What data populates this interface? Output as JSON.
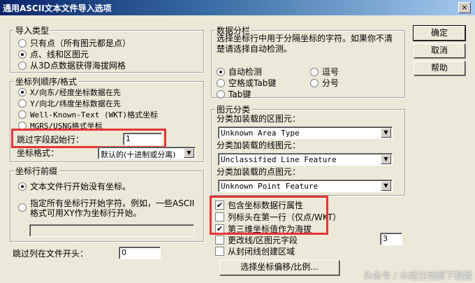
{
  "window": {
    "title": "通用ASCII文本文件导入选项",
    "close": "×"
  },
  "import_type": {
    "legend": "导入类型",
    "options": [
      "只有点（所有图元都是点）",
      "点、线和区图元",
      "从3D点数据获得海拔网格"
    ],
    "selected": 1
  },
  "coord_order": {
    "legend": "坐标列顺序/格式",
    "options": [
      "X/向东/经度坐标数据在先",
      "Y/向北/纬度坐标数据在先",
      "Well-Known-Text (WKT)格式坐标",
      "MGRS/USNG格式坐标"
    ],
    "selected": 0,
    "skip_label": "跳过字段起始行：",
    "skip_value": "1",
    "format_label": "坐标格式：",
    "format_value": "默认的(十进制或分离)"
  },
  "prefix": {
    "legend": "坐标行前缀",
    "options": [
      "文本文件行开始没有坐标。",
      "指定所有坐标行开始字符。例如，一些ASCII格式可用XY作为坐标行开始。"
    ],
    "selected": 0,
    "prefix_value": ""
  },
  "skip_columns": {
    "label": "跳过列在文件开头：",
    "value": "0"
  },
  "delimiter": {
    "legend": "数据分栏",
    "description": "选择坐标行中用于分隔坐标的字符。如果你不清楚请选择自动检测。",
    "options": [
      "自动检测",
      "逗号",
      "空格或Tab键",
      "分号",
      "Tab键"
    ],
    "selected": 0
  },
  "feature_class": {
    "legend": "图元分类",
    "area_label": "分类加装载的区图元：",
    "area_value": "Unknown Area Type",
    "line_label": "分类加装载的线图元：",
    "line_value": "Unclassified Line Feature",
    "point_label": "分类加装载的点图元：",
    "point_value": "Unknown Point Feature"
  },
  "checkboxes": {
    "include_attr": {
      "label": "包含坐标数据行属性",
      "checked": true
    },
    "column_header": {
      "label": "列标头在第一行（仅点/WKT）",
      "checked": false
    },
    "third_coord": {
      "label": "第三维坐标值作为海拔",
      "checked": true
    },
    "change_field": {
      "label": "更改线/区图元字段",
      "checked": false,
      "value": "3"
    },
    "closed_line": {
      "label": "从封闭线创建区域",
      "checked": false
    }
  },
  "buttons": {
    "ok": "确定",
    "cancel": "取消",
    "help": "帮助",
    "projection": "选择坐标偏移/比例..."
  },
  "watermark": "头条号 / 水经注地图下载器"
}
